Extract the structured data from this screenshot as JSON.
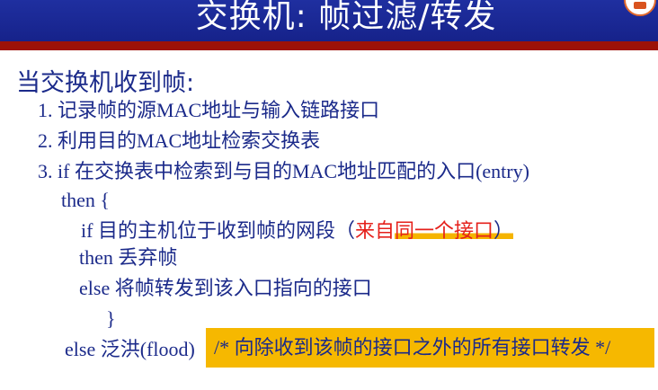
{
  "title": "交换机: 帧过滤/转发",
  "intro": "当交换机收到帧:",
  "steps": [
    "1. 记录帧的源MAC地址与输入链路接口",
    "2. 利用目的MAC地址检索交换表",
    "3. if 在交换表中检索到与目的MAC地址匹配的入口(entry)"
  ],
  "code": {
    "then_open": "then {",
    "if_prefix": "if 目的主机位于收到帧的网段（",
    "if_red_a": "来自",
    "if_red_b": "同一个接口",
    "if_close": "）",
    "then_drop": "then 丢弃帧",
    "else_forward": "else 将帧转发到该入口指向的接口",
    "close_brace": "}",
    "else_flood": "else 泛洪(flood)",
    "comment": "/* 向除收到该帧的接口之外的所有接口转发 */"
  },
  "colors": {
    "title_bar": "#1f2fa0",
    "accent_band": "#9c1208",
    "text": "#1b2a8a",
    "emphasis": "#e5201b",
    "highlight": "#f6b800"
  }
}
